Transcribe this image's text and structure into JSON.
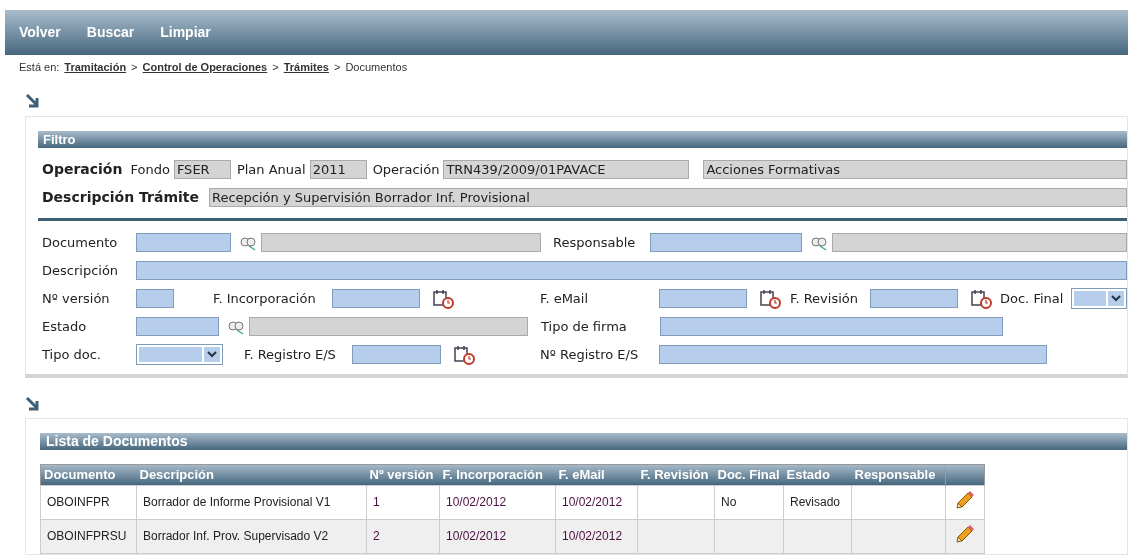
{
  "menu": [
    {
      "label": "Volver"
    },
    {
      "label": "Buscar"
    },
    {
      "label": "Limpiar"
    }
  ],
  "breadcrumb": {
    "prefix": "Está en:",
    "links": [
      "Tramitación",
      "Control de Operaciones",
      "Trámites"
    ],
    "separators": [
      ">",
      ">",
      ">"
    ],
    "current": "Documentos"
  },
  "filter": {
    "title": "Filtro",
    "operacion": {
      "label": "Operación",
      "fields": [
        {
          "label": "Fondo",
          "value": "FSER"
        },
        {
          "label": "Plan Anual",
          "value": "2011"
        },
        {
          "label": "Operación",
          "value": "TRN439/2009/01PAVACE"
        },
        {
          "value": "Acciones Formativas"
        }
      ]
    },
    "descripcion_tramite": {
      "label": "Descripción Trámite",
      "value": "Recepción y Supervisión Borrador Inf. Provisional"
    },
    "rows": [
      [
        {
          "label": "Documento",
          "kind": "lookup"
        },
        {
          "label": "Responsable",
          "kind": "lookup"
        }
      ],
      [
        {
          "label": "Descripción",
          "kind": "text"
        }
      ],
      [
        {
          "label": "Nº versión",
          "kind": "text"
        },
        {
          "label": "F. Incorporación",
          "kind": "date"
        },
        {
          "label": "F. eMail",
          "kind": "date"
        },
        {
          "label": "F. Revisión",
          "kind": "date"
        },
        {
          "label": "Doc. Final",
          "kind": "select"
        }
      ],
      [
        {
          "label": "Estado",
          "kind": "lookup"
        },
        {
          "label": "Tipo de firma",
          "kind": "text"
        }
      ],
      [
        {
          "label": "Tipo doc.",
          "kind": "select"
        },
        {
          "label": "F. Registro E/S",
          "kind": "date"
        },
        {
          "label": "Nº Registro E/S",
          "kind": "text"
        }
      ]
    ]
  },
  "list": {
    "title": "Lista de Documentos",
    "columns": [
      "Documento",
      "Descripción",
      "Nº versión",
      "F. Incorporación",
      "F. eMail",
      "F. Revisión",
      "Doc. Final",
      "Estado",
      "Responsable"
    ],
    "rows": [
      [
        "OBOINFPR",
        "Borrador de Informe Provisional V1",
        "1",
        "10/02/2012",
        "10/02/2012",
        "",
        "No",
        "Revisado",
        ""
      ],
      [
        "OBOINFPRSU",
        "Borrador Inf. Prov. Supervisado V2",
        "2",
        "10/02/2012",
        "10/02/2012",
        "",
        "",
        "",
        ""
      ]
    ]
  }
}
